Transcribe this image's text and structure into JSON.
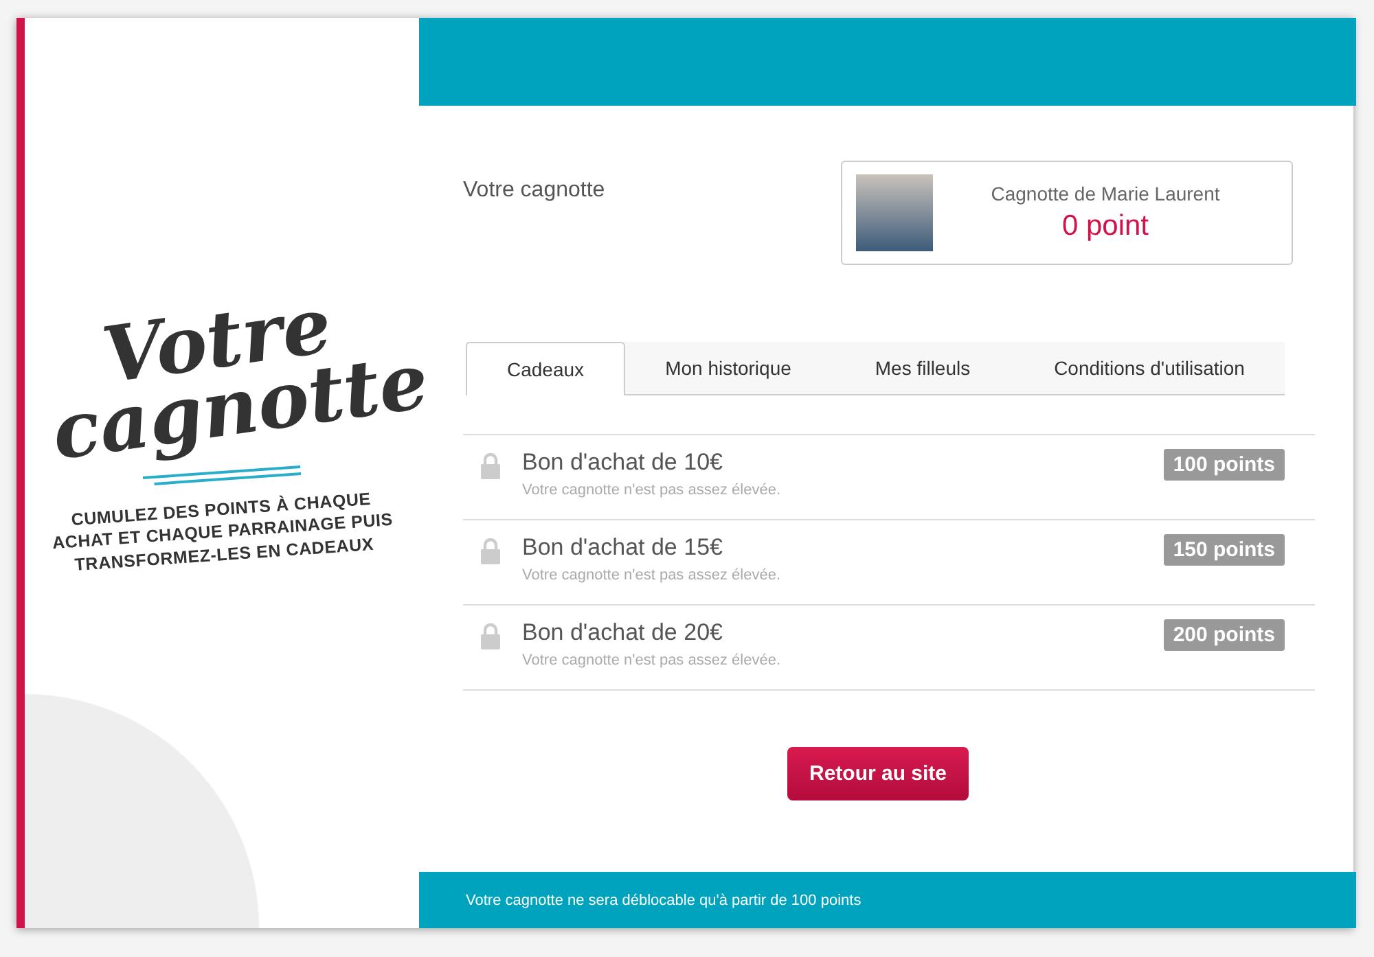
{
  "brand": {
    "logo_line_1": "Votre",
    "logo_line_2": "cagnotte",
    "tagline": "CUMULEZ DES POINTS À CHAQUE ACHAT ET CHAQUE PARRAINAGE PUIS TRANSFORMEZ-LES EN CADEAUX"
  },
  "section_title": "Votre cagnotte",
  "account": {
    "owner": "Cagnotte de Marie Laurent",
    "balance": "0 point"
  },
  "tabs": [
    {
      "label": "Cadeaux",
      "selected": true
    },
    {
      "label": "Mon historique",
      "selected": false
    },
    {
      "label": "Mes filleuls",
      "selected": false
    },
    {
      "label": "Conditions d'utilisation",
      "selected": false
    }
  ],
  "rewards": [
    {
      "title": "Bon d'achat de 10€",
      "note": "Votre cagnotte n'est pas assez élevée.",
      "cost": "100 points",
      "locked": true
    },
    {
      "title": "Bon d'achat de 15€",
      "note": "Votre cagnotte n'est pas assez élevée.",
      "cost": "150 points",
      "locked": true
    },
    {
      "title": "Bon d'achat de 20€",
      "note": "Votre cagnotte n'est pas assez élevée.",
      "cost": "200 points",
      "locked": true
    }
  ],
  "back_button": "Retour au site",
  "footer": "Votre cagnotte ne sera déblocable qu'à partir de 100 points"
}
